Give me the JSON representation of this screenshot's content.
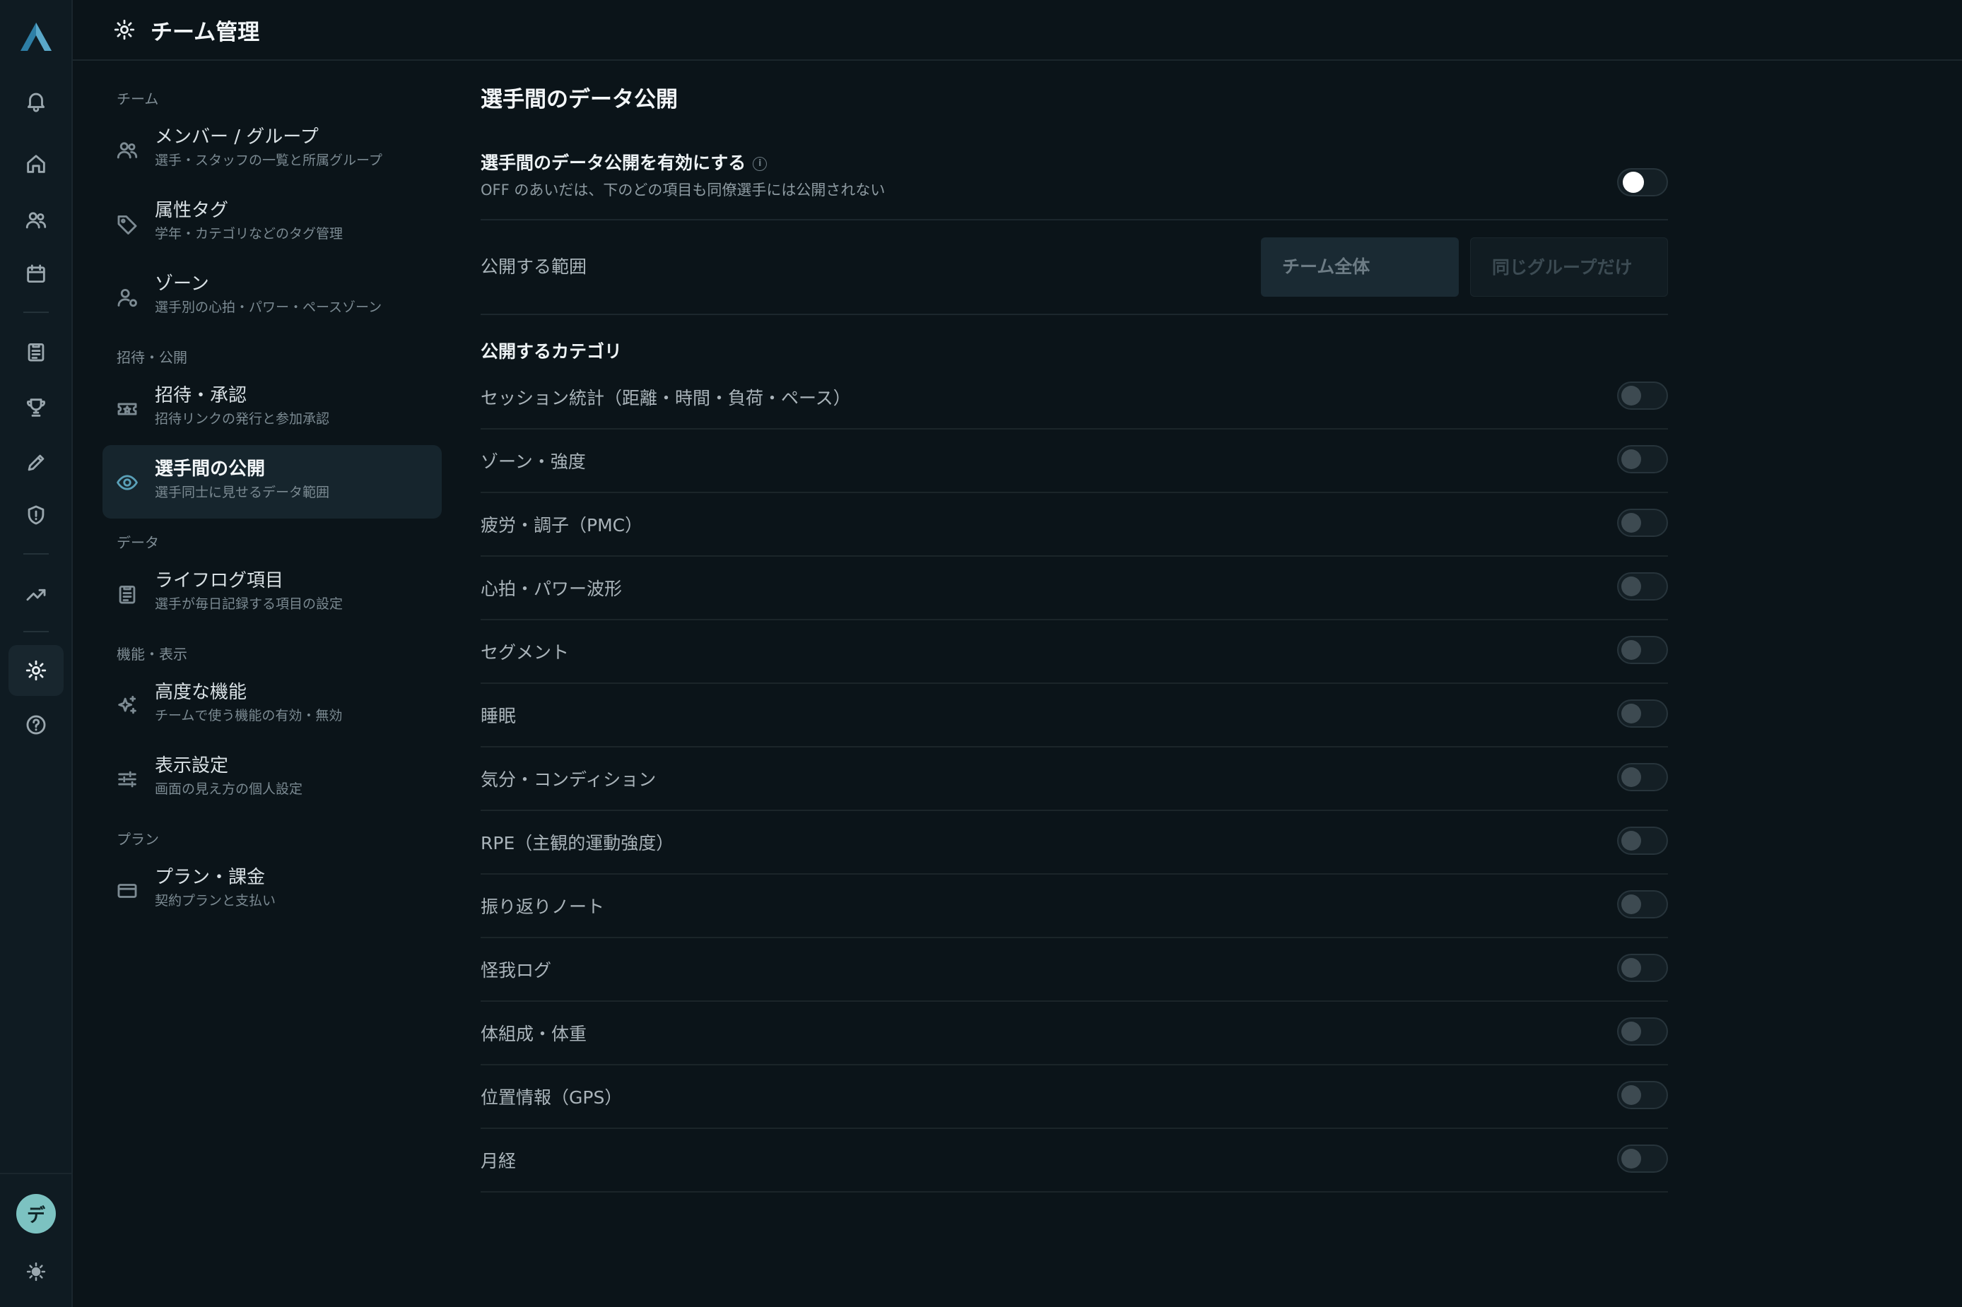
{
  "header": {
    "title": "チーム管理"
  },
  "rail": {
    "avatar_initial": "デ",
    "icons": [
      "bell-icon",
      "home-icon",
      "users-icon",
      "calendar-icon",
      "clipboard-icon",
      "trophy-icon",
      "pencil-icon",
      "shield-icon",
      "trend-icon",
      "gear-icon",
      "help-icon",
      "sun-icon"
    ]
  },
  "nav": {
    "sections": {
      "team": "チーム",
      "invite": "招待・公開",
      "data": "データ",
      "features": "機能・表示",
      "plan": "プラン"
    },
    "items": [
      {
        "label": "メンバー / グループ",
        "sub": "選手・スタッフの一覧と所属グループ"
      },
      {
        "label": "属性タグ",
        "sub": "学年・カテゴリなどのタグ管理"
      },
      {
        "label": "ゾーン",
        "sub": "選手別の心拍・パワー・ペースゾーン"
      },
      {
        "label": "招待・承認",
        "sub": "招待リンクの発行と参加承認"
      },
      {
        "label": "選手間の公開",
        "sub": "選手同士に見せるデータ範囲"
      },
      {
        "label": "ライフログ項目",
        "sub": "選手が毎日記録する項目の設定"
      },
      {
        "label": "高度な機能",
        "sub": "チームで使う機能の有効・無効"
      },
      {
        "label": "表示設定",
        "sub": "画面の見え方の個人設定"
      },
      {
        "label": "プラン・課金",
        "sub": "契約プランと支払い"
      }
    ]
  },
  "main": {
    "title": "選手間のデータ公開",
    "master": {
      "label": "選手間のデータ公開を有効にする",
      "info_glyph": "i",
      "sub": "OFF のあいだは、下のどの項目も同僚選手には公開されない",
      "on": false
    },
    "scope": {
      "label": "公開する範囲",
      "options": [
        "チーム全体",
        "同じグループだけ"
      ]
    },
    "categories_title": "公開するカテゴリ",
    "categories": [
      "セッション統計（距離・時間・負荷・ペース）",
      "ゾーン・強度",
      "疲労・調子（PMC）",
      "心拍・パワー波形",
      "セグメント",
      "睡眠",
      "気分・コンディション",
      "RPE（主観的運動強度）",
      "振り返りノート",
      "怪我ログ",
      "体組成・体重",
      "位置情報（GPS）",
      "月経"
    ]
  }
}
